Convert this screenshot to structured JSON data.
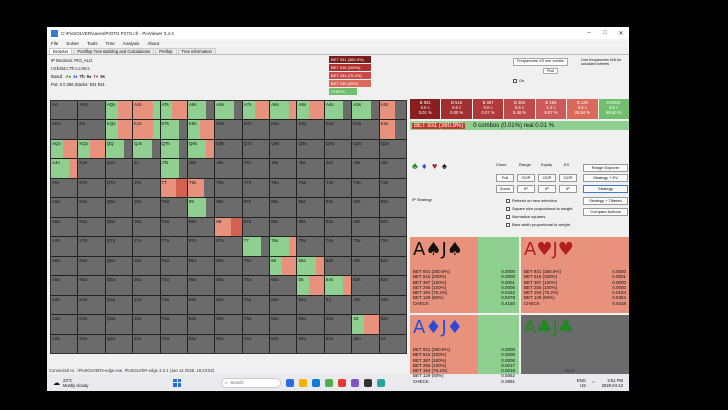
{
  "window": {
    "title": "C:\\PioSOLVER\\saves\\PIOTO P27O.cfr - PioViewer 3.4.4"
  },
  "menu": [
    "File",
    "Solver",
    "Tools",
    "Tree",
    "Analysis",
    "About"
  ],
  "tabs": [
    "Browser",
    "Postflop Tree Building and Calculations",
    "Preflop",
    "Tree information"
  ],
  "info": {
    "decision": "IP Decision:   PIO_ALG",
    "path": "r:0:b4t4:c:Th:c:c:9s:c",
    "board_label": "Board",
    "board_cards": [
      {
        "t": "A♣",
        "c": "#2a9d2a"
      },
      {
        "t": "4♦",
        "c": "#2b4ad8"
      },
      {
        "t": "Th",
        "c": "#222"
      },
      {
        "t": "9♠",
        "c": "#222"
      },
      {
        "t": "T♥",
        "c": "#c0392b"
      },
      {
        "t": "9s",
        "c": "#222"
      }
    ],
    "pot": "Pot: 0 0 256 Stacks: 931 931"
  },
  "actions": [
    {
      "label": "BET 931 (360.9%)",
      "color": "#7a1c1c"
    },
    {
      "label": "BET 516 (200%)",
      "color": "#b03030"
    },
    {
      "label": "BET 194 (75.2%)",
      "color": "#c84a4a"
    },
    {
      "label": "BET 129 (50%)",
      "color": "#d96a5a"
    },
    {
      "label": "CHECK",
      "color": "#6fbf6f"
    }
  ],
  "right_top": {
    "freq_label": "Frequencies VS one combo",
    "pick": "Pick",
    "line_freq": "Line frequencies N/A for unloaded streets",
    "on_label": "On"
  },
  "strategy_boxes": [
    {
      "t": "B 931",
      "v1": "0.0 c",
      "v2": "0.01 %",
      "color": "#8a1f1f"
    },
    {
      "t": "B 516",
      "v1": "0.0 c",
      "v2": "0.00 %",
      "color": "#a33030"
    },
    {
      "t": "B 387",
      "v1": "0.0 c",
      "v2": "0.07 %",
      "color": "#b03a3a"
    },
    {
      "t": "B 256",
      "v1": "0.6 c",
      "v2": "5.48 %",
      "color": "#bf4a4a"
    },
    {
      "t": "B 194",
      "v1": "1.2 c",
      "v2": "8.07 %",
      "color": "#cc5a5a"
    },
    {
      "t": "B 129",
      "v1": "3.8 c",
      "v2": "26.84 %",
      "color": "#d96a5a"
    },
    {
      "t": "CHECK",
      "v1": "8.5 c",
      "v2": "59.50 %",
      "color": "#6fbf6f"
    }
  ],
  "bet_line": {
    "pill": "BET 931 (360.9%)",
    "text": "0 combos (0.01%) real  0.01 %"
  },
  "ctrl": {
    "headers": [
      "Clone",
      "Range",
      "Equity",
      "EV"
    ],
    "buttons": [
      "Full",
      "OOP",
      "OOP",
      "OOP",
      "Zoom",
      "IP",
      "IP",
      "IP"
    ],
    "side_buttons": [
      "Range Explorer",
      "Strategy + EV",
      "Strategy",
      "Strategy + Tiltered",
      "Compare Actions"
    ],
    "ip_strategy": "IP Strategy",
    "checkboxes": [
      "Refresh on new selection",
      "Square size proportional to weight",
      "Normalize squares",
      "Bars width proportional to weight"
    ]
  },
  "combos": [
    {
      "card1": "A",
      "s1": "♠",
      "card2": "J",
      "s2": "♠",
      "color": "#111",
      "bg": "#e8927e",
      "green": "38%",
      "rows": [
        [
          "BET 931 (360.9%)",
          "0.0000"
        ],
        [
          "BET 516 (200%)",
          "0.0000"
        ],
        [
          "BET 387 (150%)",
          "0.0001"
        ],
        [
          "BET 256 (100%)",
          "0.0000"
        ],
        [
          "BET 194 (75.2%)",
          "0.0422"
        ],
        [
          "BET 129 (50%)",
          "0.5378"
        ],
        [
          "CHECK",
          "0.4160"
        ]
      ]
    },
    {
      "card1": "A",
      "s1": "♥",
      "card2": "J",
      "s2": "♥",
      "color": "#b21f1f",
      "bg": "#e8927e",
      "green": "0%",
      "rows": [
        [
          "BET 931 (360.9%)",
          "0.0000"
        ],
        [
          "BET 516 (200%)",
          "0.0001"
        ],
        [
          "BET 387 (150%)",
          "0.0000"
        ],
        [
          "BET 256 (100%)",
          "0.0000"
        ],
        [
          "BET 194 (75.2%)",
          "0.0184"
        ],
        [
          "BET 129 (50%)",
          "0.9354"
        ],
        [
          "CHECK",
          "0.0418"
        ]
      ]
    },
    {
      "card1": "A",
      "s1": "♦",
      "card2": "J",
      "s2": "♦",
      "color": "#2b4ad8",
      "bg": "#e8927e",
      "green": "38%",
      "rows": [
        [
          "BET 931 (360.9%)",
          "0.0000"
        ],
        [
          "BET 516 (200%)",
          "0.0000"
        ],
        [
          "BET 387 (150%)",
          "0.0000"
        ],
        [
          "BET 256 (100%)",
          "0.0017"
        ],
        [
          "BET 194 (75.2%)",
          "0.0018"
        ],
        [
          "BET 129 (50%)",
          "0.5552"
        ],
        [
          "CHECK",
          "0.3991"
        ]
      ]
    },
    {
      "card1": "A",
      "s1": "♣",
      "card2": "J",
      "s2": "♣",
      "color": "#1f8a1f",
      "bg": "#6b6b6b",
      "green": "0%",
      "rows": []
    }
  ],
  "grid": {
    "ranks": [
      "A",
      "K",
      "Q",
      "J",
      "T",
      "9",
      "8",
      "7",
      "6",
      "5",
      "4",
      "3",
      "2"
    ],
    "cells": {
      "AA": "g",
      "AKs": "g",
      "AQs": "r1",
      "AJs": "r3",
      "ATs": "r1",
      "A9s": "g1",
      "A8s": "g1",
      "A7s": "r1",
      "A6s": "r2",
      "A5s": "r1",
      "A4s": "g1",
      "A3s": "g1",
      "A2s": "r4",
      "AKo": "g",
      "KK": "g",
      "KQs": "r1",
      "KJs": "r3",
      "KTs": "g1",
      "K9s": "r1",
      "K8s": "g",
      "K7s": "g",
      "K6s": "g",
      "K5s": "g",
      "K4s": "g",
      "K3s": "g",
      "K2s": "r4",
      "AQo": "r1",
      "KQo": "r1",
      "QQ": "g1",
      "QJs": "g1",
      "QTs": "g1",
      "Q9s": "r2",
      "Q8s": "g",
      "Q7s": "g",
      "Q6s": "g",
      "Q5s": "g",
      "Q4s": "g",
      "Q3s": "g",
      "Q2s": "g",
      "AJo": "r2",
      "KJo": "g",
      "QJo": "g",
      "JJ": "g",
      "JTs": "g1",
      "J9s": "g",
      "J8s": "g",
      "J7s": "g",
      "J6s": "g",
      "J5s": "g",
      "J4s": "g",
      "J3s": "g",
      "J2s": "g",
      "ATo": "g",
      "KTo": "g",
      "QTo": "g",
      "JTo": "g",
      "TT": "r5",
      "T9s": "r4",
      "T8s": "g",
      "T7s": "g",
      "T6s": "g",
      "T5s": "g",
      "T4s": "g",
      "T3s": "g",
      "T2s": "g",
      "A9o": "g",
      "K9o": "g",
      "Q9o": "g",
      "J9o": "g",
      "T9o": "g",
      "99": "g1",
      "98s": "g",
      "97s": "g",
      "96s": "g",
      "95s": "g",
      "94s": "g",
      "93s": "g",
      "92s": "g",
      "A8o": "g",
      "K8o": "g",
      "Q8o": "g",
      "J8o": "g",
      "T8o": "g",
      "98o": "g",
      "88": "r5",
      "87s": "g",
      "86s": "g",
      "85s": "g",
      "84s": "g",
      "83s": "g",
      "82s": "g",
      "A7o": "g",
      "K7o": "g",
      "Q7o": "g",
      "J7o": "g",
      "T7o": "g",
      "97o": "g",
      "87o": "g",
      "77": "g1",
      "76s": "r2",
      "75s": "g",
      "74s": "g",
      "73s": "g",
      "72s": "g",
      "A6o": "g",
      "K6o": "g",
      "Q6o": "g",
      "J6o": "g",
      "T6o": "g",
      "96o": "g",
      "86o": "g",
      "76o": "g",
      "66": "r1",
      "65s": "r2",
      "64s": "g",
      "63s": "g",
      "62s": "g",
      "A5o": "g",
      "K5o": "g",
      "Q5o": "g",
      "J5o": "g",
      "T5o": "g",
      "95o": "g",
      "85o": "g",
      "75o": "g",
      "65o": "g",
      "55": "r1",
      "54s": "r2",
      "53s": "g",
      "52s": "g",
      "A4o": "g",
      "K4o": "g",
      "Q4o": "g",
      "J4o": "g",
      "T4o": "g",
      "94o": "g",
      "84o": "g",
      "74o": "g",
      "64o": "g",
      "54o": "g",
      "44": "g",
      "43s": "g",
      "42s": "g",
      "A3o": "g",
      "K3o": "g",
      "Q3o": "g",
      "J3o": "g",
      "T3o": "g",
      "93o": "g",
      "83o": "g",
      "73o": "g",
      "63o": "g",
      "53o": "g",
      "43o": "g",
      "33": "r1",
      "32s": "g",
      "A2o": "g",
      "K2o": "g",
      "Q2o": "g",
      "J2o": "g",
      "T2o": "g",
      "92o": "g",
      "82o": "g",
      "72o": "g",
      "62o": "g",
      "52o": "g",
      "42o": "g",
      "32o": "g",
      "22": "g"
    }
  },
  "status": "Connected to: .\\PioSOLVER3-edge.exe, PioSOLVER-edge 3.3.1 (Jan 14 2025, 18:23:53)",
  "status_right": "Done",
  "taskbar": {
    "temp": "23°C",
    "weather": "Mostly cloudy",
    "search": "Search",
    "lang1": "ENG",
    "lang2": "US",
    "time": "2:51 PM",
    "date": "2025-04-13"
  }
}
